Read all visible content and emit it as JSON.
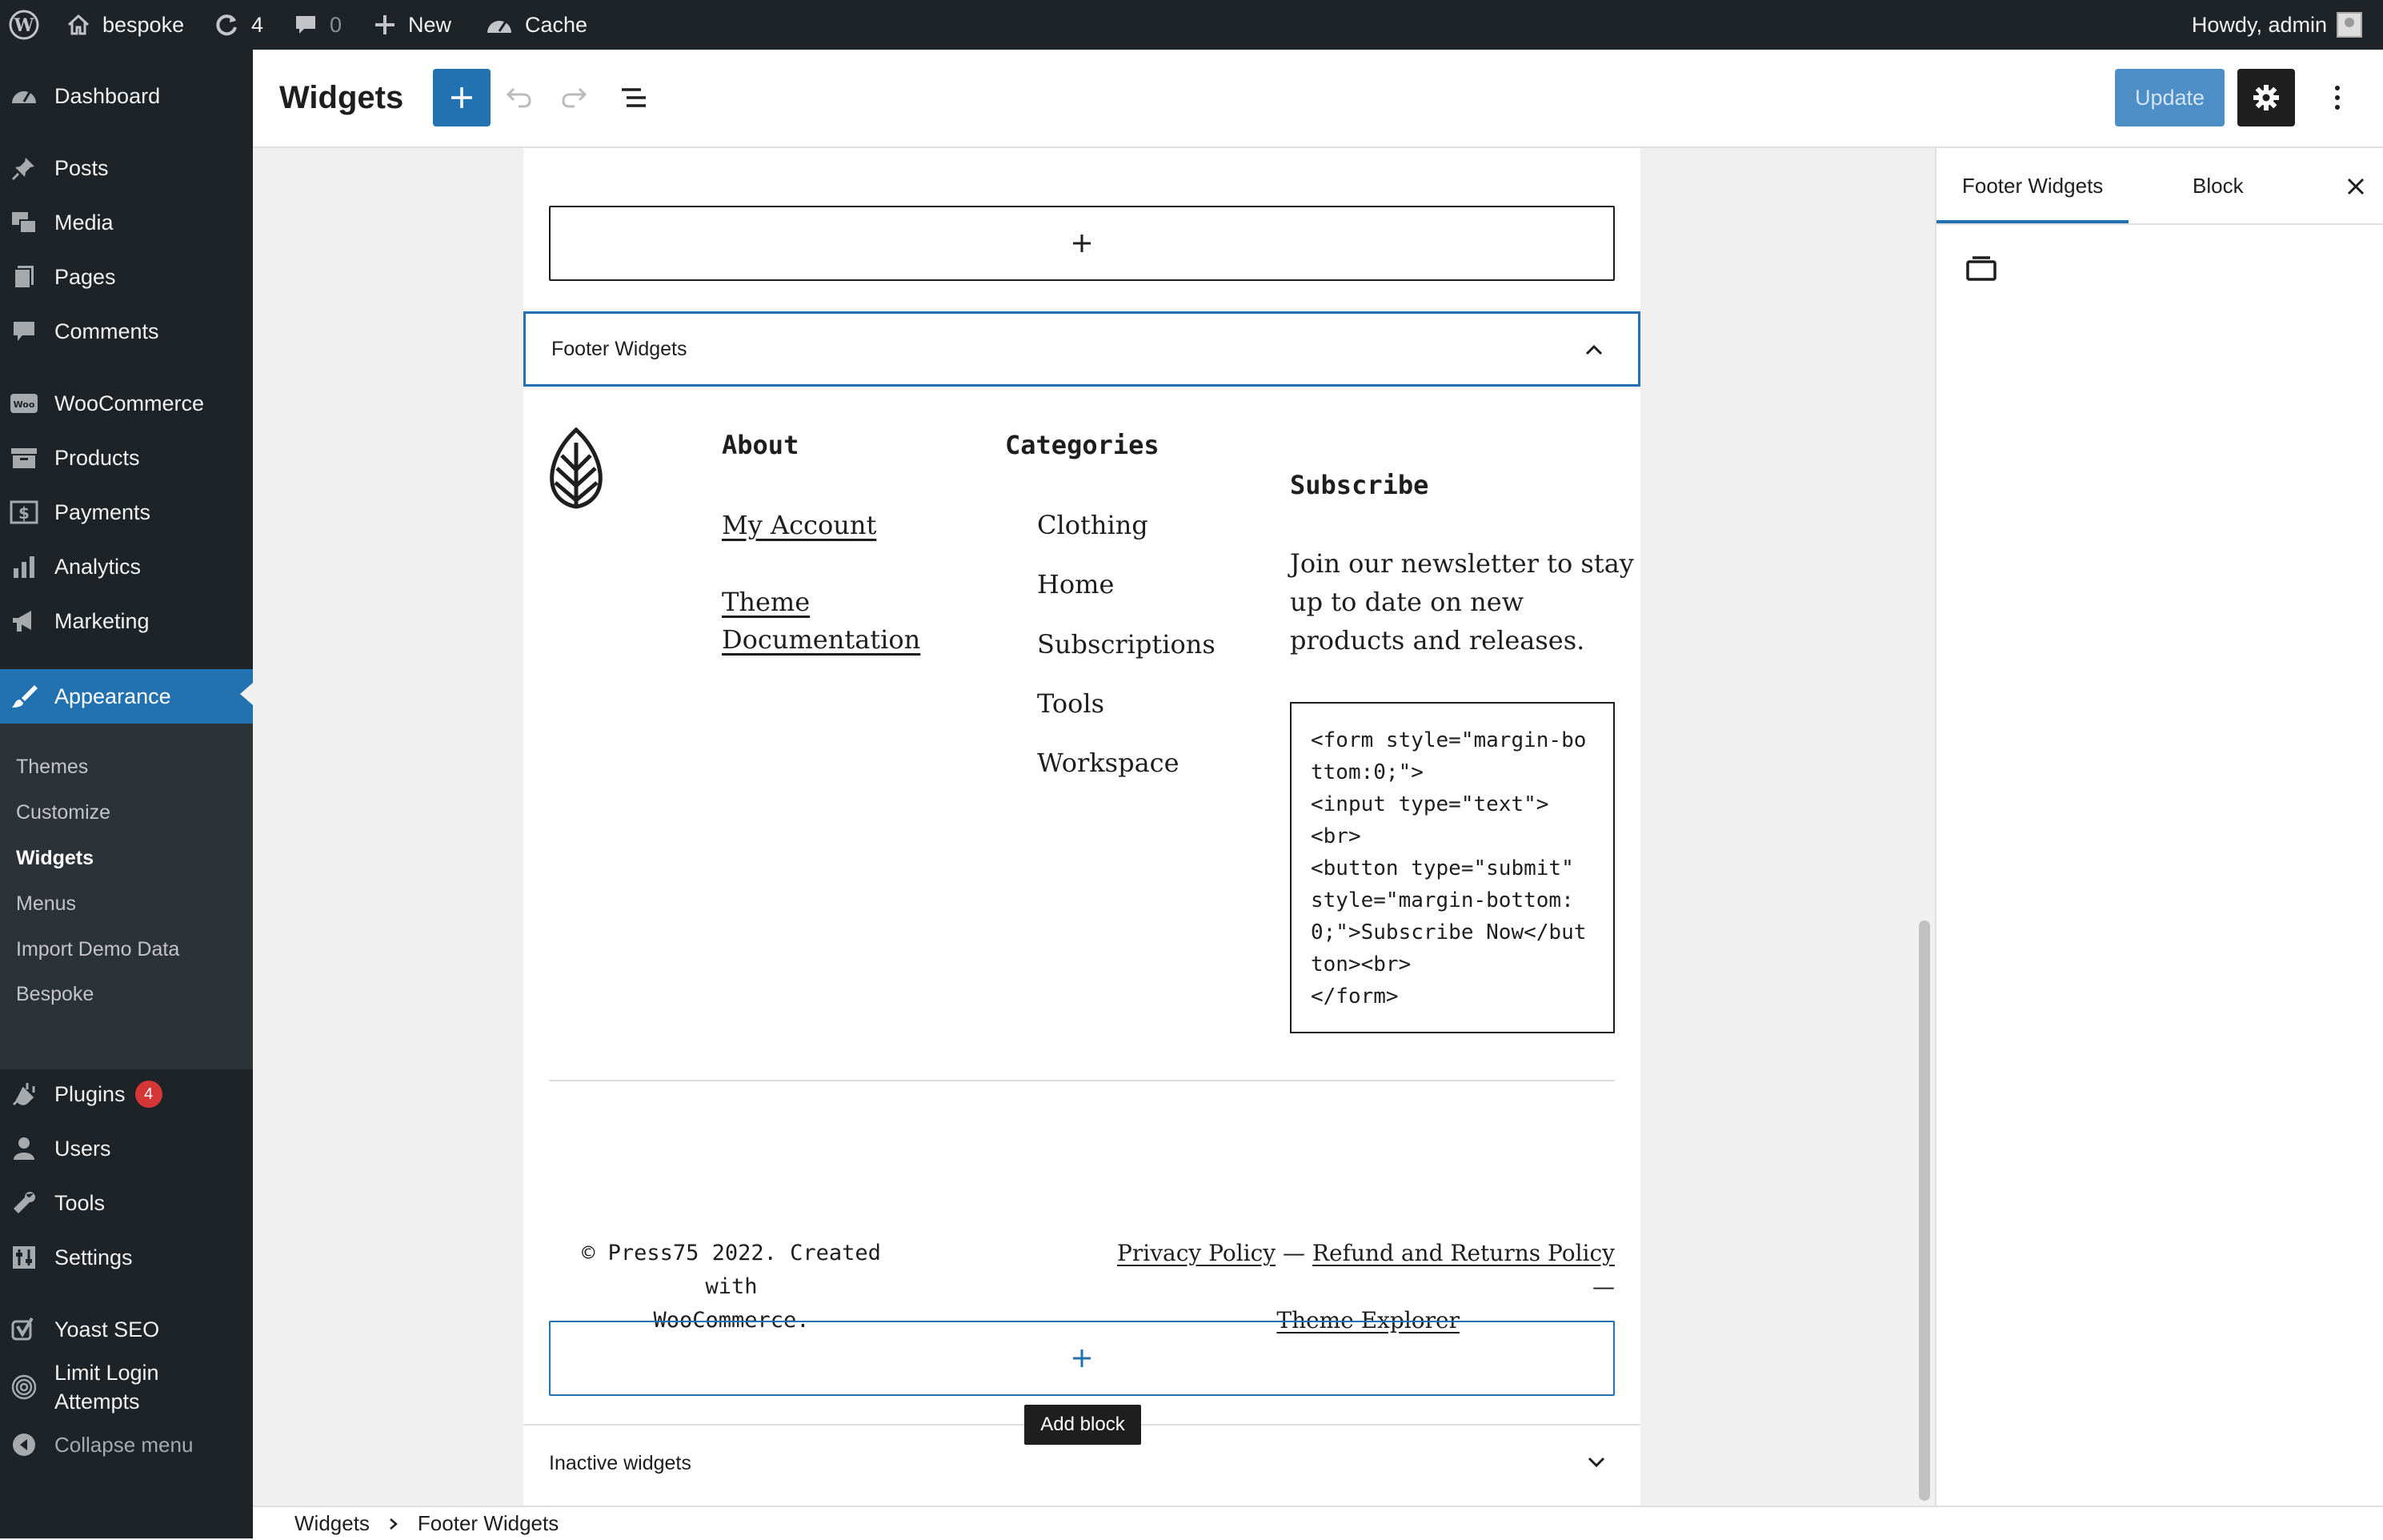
{
  "admin_bar": {
    "site_name": "bespoke",
    "updates_count": "4",
    "comments_count": "0",
    "new_label": "New",
    "cache_label": "Cache",
    "howdy": "Howdy, admin"
  },
  "sidebar": {
    "dashboard": "Dashboard",
    "posts": "Posts",
    "media": "Media",
    "pages": "Pages",
    "comments": "Comments",
    "woocommerce": "WooCommerce",
    "products": "Products",
    "payments": "Payments",
    "analytics": "Analytics",
    "marketing": "Marketing",
    "appearance": "Appearance",
    "submenu": [
      "Themes",
      "Customize",
      "Widgets",
      "Menus",
      "Import Demo Data",
      "Bespoke"
    ],
    "plugins": "Plugins",
    "plugins_badge": "4",
    "users": "Users",
    "tools": "Tools",
    "settings": "Settings",
    "yoast": "Yoast SEO",
    "limit_login_1": "Limit Login",
    "limit_login_2": "Attempts",
    "collapse": "Collapse menu"
  },
  "header": {
    "title": "Widgets",
    "update_label": "Update"
  },
  "canvas": {
    "footer_widgets_title": "Footer Widgets",
    "about_title": "About",
    "about_links": [
      "My Account",
      "Theme",
      "Documentation"
    ],
    "categories_title": "Categories",
    "categories": [
      "Clothing",
      "Home",
      "Subscriptions",
      "Tools",
      "Workspace"
    ],
    "subscribe_title": "Subscribe",
    "subscribe_text": [
      "Join our newsletter to stay",
      "up to date on new",
      "products and releases."
    ],
    "code_html": "<form style=\"margin-bottom:0;\">\n<input type=\"text\">\n<br>\n<button type=\"submit\" style=\"margin-bottom:0;\">Subscribe Now</button><br>\n</form>",
    "copyright_1": "© Press75 2022. Created with",
    "copyright_2": "WooCommerce.",
    "privacy": "Privacy Policy",
    "dash": "—",
    "refund": "Refund and Returns Policy",
    "theme_explorer": "Theme Explorer",
    "add_block_tooltip": "Add block",
    "inactive_widgets": "Inactive widgets"
  },
  "inspector": {
    "tab_area": "Footer Widgets",
    "tab_block": "Block"
  },
  "breadcrumb": {
    "root": "Widgets",
    "current": "Footer Widgets"
  },
  "colors": {
    "admin_dark": "#1d2327",
    "accent": "#2271b1",
    "badge": "#d63638"
  }
}
